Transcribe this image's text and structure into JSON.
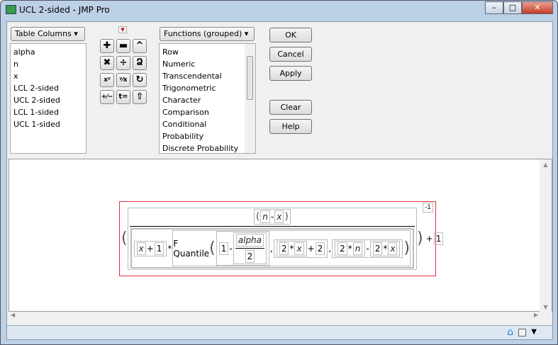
{
  "window": {
    "title": "UCL 2-sided - JMP Pro",
    "minimize": "–",
    "maximize": "□",
    "close": "✕"
  },
  "columns": {
    "dropdown": "Table Columns ▾",
    "items": [
      "alpha",
      "n",
      "x",
      "LCL 2-sided",
      "UCL 2-sided",
      "LCL 1-sided",
      "UCL 1-sided"
    ]
  },
  "keypad": [
    "✚",
    "▬",
    "^",
    "✖",
    "÷",
    "Ձ",
    "xʸ",
    "ʸ⁄x",
    "↻",
    "+⁄−",
    "t=",
    "⇧"
  ],
  "functions": {
    "dropdown": "Functions (grouped) ▾",
    "items": [
      "Row",
      "Numeric",
      "Transcendental",
      "Trigonometric",
      "Character",
      "Comparison",
      "Conditional",
      "Probability",
      "Discrete Probability"
    ]
  },
  "buttons": {
    "ok": "OK",
    "cancel": "Cancel",
    "apply": "Apply",
    "clear": "Clear",
    "help": "Help"
  },
  "formula": {
    "n": "n",
    "minus": "-",
    "x": "x",
    "plus": "+",
    "one": "1",
    "two": "2",
    "times": "*",
    "fquantile": "F Quantile",
    "alpha": "alpha",
    "comma": ",",
    "exponent": "-1"
  },
  "status": {
    "home": "⌂",
    "menu": "▼"
  }
}
